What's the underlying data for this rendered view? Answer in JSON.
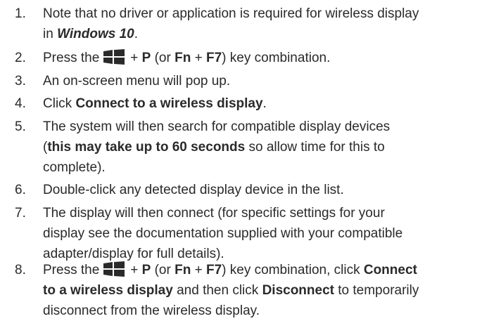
{
  "items": [
    {
      "number": "1.",
      "lines": [
        [
          "Note that no driver or application is required for wireless display"
        ],
        [
          "in ",
          "Windows 10",
          "."
        ]
      ]
    },
    {
      "number": "2.",
      "parts": [
        "Press the",
        "+ ",
        "P",
        " (or ",
        "Fn",
        " + ",
        "F7",
        ") key combination."
      ]
    },
    {
      "number": "3.",
      "text": "An on-screen menu will pop up."
    },
    {
      "number": "4.",
      "parts": [
        "Click ",
        "Connect to a wireless display",
        "."
      ]
    },
    {
      "number": "5.",
      "lines": [
        [
          "The system will then search for compatible display devices"
        ],
        [
          "(",
          "this may take up to 60 seconds",
          " so allow time for this to"
        ],
        [
          "complete)."
        ]
      ]
    },
    {
      "number": "6.",
      "text": "Double-click any detected display device in the list."
    },
    {
      "number": "7.",
      "lines": [
        [
          "The display will then connect (for specific settings for your"
        ],
        [
          "display see the documentation supplied with your compatible"
        ],
        [
          "adapter/display for full details)."
        ]
      ]
    },
    {
      "number": "8.",
      "lines": [
        [
          "Press the",
          "+ ",
          "P",
          " (or ",
          "Fn",
          " + ",
          "F7",
          ") key combination, click ",
          "Connect"
        ],
        [
          "to a wireless display",
          " and then click ",
          "Disconnect",
          " to temporarily"
        ],
        [
          "disconnect from the wireless display."
        ]
      ]
    }
  ],
  "icon": {
    "name": "windows-key-icon",
    "color": "#2a2a2a"
  },
  "colors": {
    "text": "#2a2a2a",
    "background": "#ffffff"
  }
}
